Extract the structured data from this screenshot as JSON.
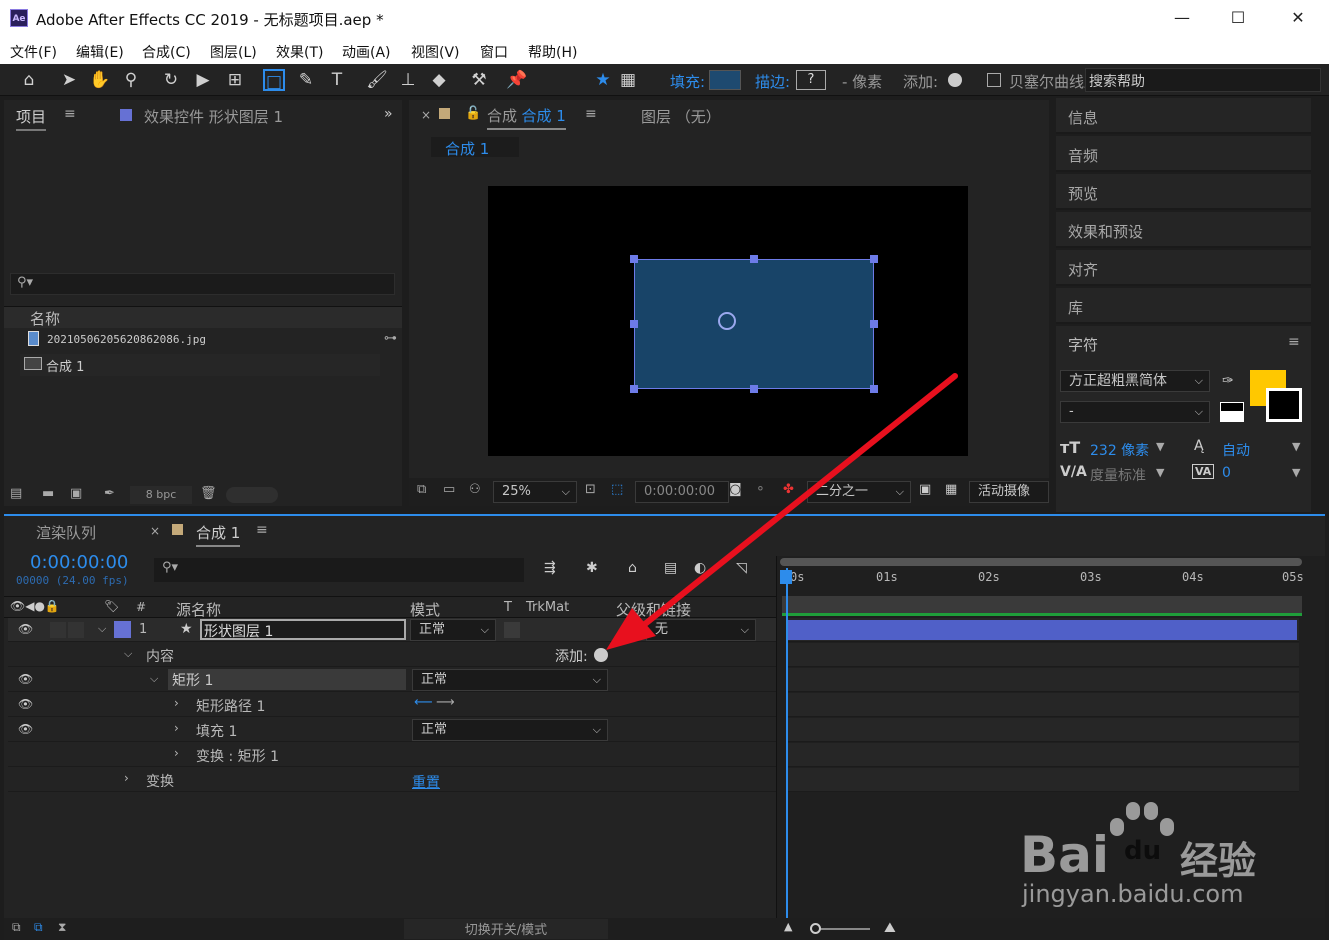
{
  "window": {
    "title": "Adobe After Effects CC 2019 - 无标题项目.aep *",
    "logo": "Ae"
  },
  "menu": [
    "文件(F)",
    "编辑(E)",
    "合成(C)",
    "图层(L)",
    "效果(T)",
    "动画(A)",
    "视图(V)",
    "窗口",
    "帮助(H)"
  ],
  "toolbar": {
    "fill": "填充:",
    "stroke": "描边:",
    "stroke_val": "?",
    "px": "- 像素",
    "add": "添加:",
    "bezier": "贝塞尔曲线路径",
    "search": "搜索帮助"
  },
  "project": {
    "tab": "项目",
    "effects_tab": "效果控件 形状图层 1",
    "col_name": "名称",
    "items": [
      "20210506205620862086.jpg",
      "合成 1"
    ],
    "bpc": "8 bpc"
  },
  "comp": {
    "tab_prefix": "合成",
    "tab_name": "合成 1",
    "layer_tab": "图层 （无）",
    "breadcrumb": "合成 1",
    "zoom": "25%",
    "time": "0:00:00:00",
    "resolution": "二分之一",
    "camera": "活动摄像"
  },
  "right_panel": {
    "items": [
      "信息",
      "音频",
      "预览",
      "效果和预设",
      "对齐",
      "库",
      "字符"
    ],
    "font": "方正超粗黑简体",
    "font_style": "-",
    "size": "232 像素",
    "leading": "自动",
    "tracking_label": "度量标准",
    "tracking_val": "0",
    "fill_color": "#ffc800"
  },
  "timeline": {
    "render_tab": "渲染队列",
    "comp_tab": "合成 1",
    "timecode": "0:00:00:00",
    "frames": "00000 (24.00 fps)",
    "headers": {
      "source": "源名称",
      "mode": "模式",
      "t": "T",
      "trkmat": "TrkMat",
      "parent": "父级和链接"
    },
    "layer": {
      "num": "1",
      "name": "形状图层 1",
      "mode": "正常",
      "parent": "无"
    },
    "contents": "内容",
    "add": "添加:",
    "rect": "矩形 1",
    "rect_mode": "正常",
    "rect_path": "矩形路径 1",
    "fill": "填充 1",
    "fill_mode": "正常",
    "transform_rect": "变换 : 矩形 1",
    "transform": "变换",
    "reset": "重置",
    "ruler": [
      "0s",
      "01s",
      "02s",
      "03s",
      "04s",
      "05s"
    ],
    "toggle": "切换开关/模式"
  },
  "watermark": {
    "brand": "Bai",
    "brand2": "du",
    "jy": "经验",
    "url": "jingyan.baidu.com"
  }
}
